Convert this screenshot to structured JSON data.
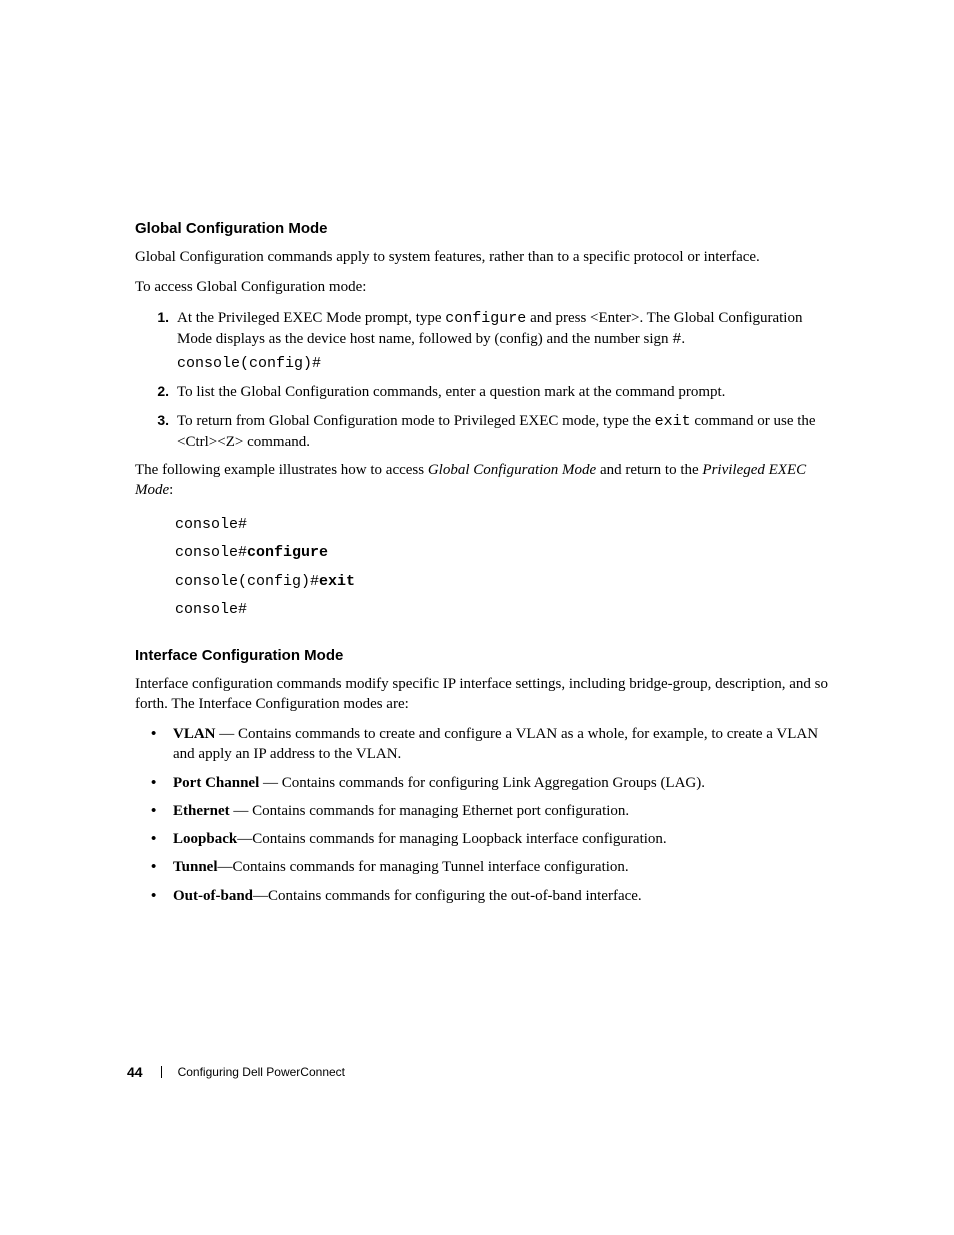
{
  "section1": {
    "heading": "Global Configuration Mode",
    "p1": "Global Configuration commands apply to system features, rather than to a specific protocol or interface.",
    "p2": "To access Global Configuration mode:",
    "step1": {
      "num": "1.",
      "before_code1": "At the Privileged EXEC Mode prompt, type ",
      "code1": "configure",
      "after_code1": " and press <Enter>. The Global Configuration Mode displays as the device host name, followed by (config) and the number sign ",
      "hash": "#",
      "period": ".",
      "codeblock": "console(config)#"
    },
    "step2": {
      "num": "2.",
      "text": "To list the Global Configuration commands, enter a question mark at the command prompt."
    },
    "step3": {
      "num": "3.",
      "before_code": "To return from Global Configuration mode to Privileged EXEC mode, type the ",
      "code": "exit",
      "after_code": " command or use the <Ctrl><Z> command."
    },
    "p3_before_i1": "The following example illustrates how to access ",
    "p3_i1": "Global Configuration Mode",
    "p3_mid": " and return to the ",
    "p3_i2": "Privileged EXEC Mode",
    "p3_end": ":",
    "code": {
      "l1": "console#",
      "l2a": "console#",
      "l2b": "configure",
      "l3a": "console(config)#",
      "l3b": "exit",
      "l4": "console#"
    }
  },
  "section2": {
    "heading": "Interface Configuration Mode",
    "p1": "Interface configuration commands modify specific IP interface settings, including bridge-group, description, and so forth. The Interface Configuration modes are:",
    "items": {
      "i1_b": "VLAN",
      "i1_t": " — Contains commands to create and configure a VLAN as a whole, for example, to create a VLAN and apply an IP address to the VLAN.",
      "i2_b": "Port Channel",
      "i2_t": " — Contains commands for configuring Link Aggregation Groups (LAG).",
      "i3_b": "Ethernet",
      "i3_t": " — Contains commands for managing Ethernet port configuration.",
      "i4_b": "Loopback",
      "i4_t": "—Contains commands for managing Loopback interface configuration.",
      "i5_b": "Tunnel",
      "i5_t": "—Contains commands for managing Tunnel interface configuration.",
      "i6_b": "Out-of-band",
      "i6_t": "—Contains commands for configuring the out-of-band interface."
    }
  },
  "footer": {
    "page": "44",
    "title": "Configuring Dell PowerConnect"
  }
}
